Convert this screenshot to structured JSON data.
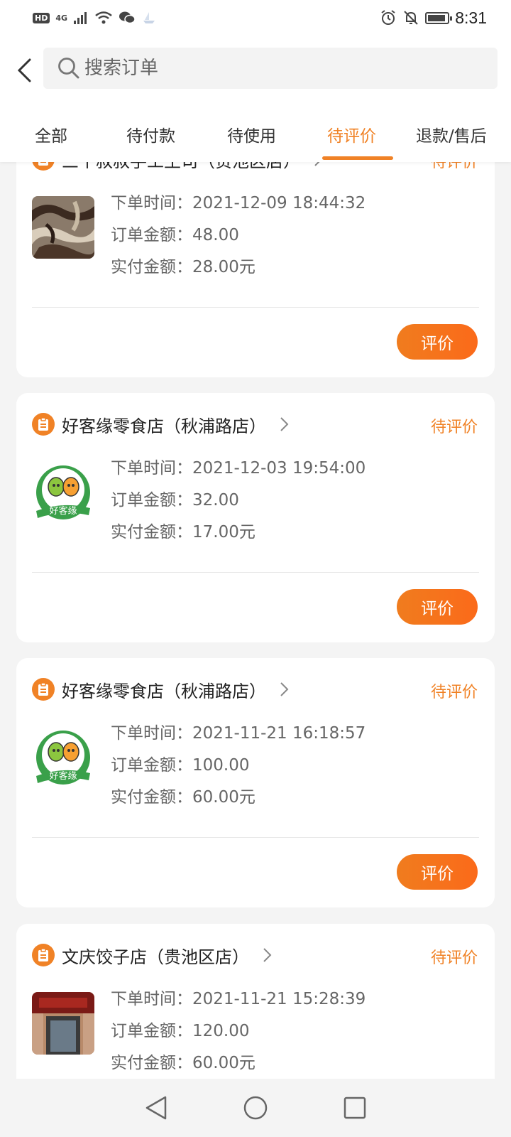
{
  "status_bar": {
    "hd": "HD",
    "signal": "4G",
    "time": "8:31"
  },
  "header": {
    "search_placeholder": "搜索订单"
  },
  "tabs": [
    {
      "label": "全部",
      "active": false
    },
    {
      "label": "待付款",
      "active": false
    },
    {
      "label": "待使用",
      "active": false
    },
    {
      "label": "待评价",
      "active": true
    },
    {
      "label": "退款/售后",
      "active": false
    }
  ],
  "labels": {
    "order_time": "下单时间：",
    "order_amount": "订单金额：",
    "paid_amount": "实付金额：",
    "review_button": "评价"
  },
  "orders": [
    {
      "shop": "三个叔叔手工土司（贵池区店）",
      "status": "待评价",
      "time": "2021-12-09 18:44:32",
      "amount": "48.00",
      "paid": "28.00元",
      "thumb_icon": "marble-bread-thumb"
    },
    {
      "shop": "好客缘零食店（秋浦路店）",
      "status": "待评价",
      "time": "2021-12-03 19:54:00",
      "amount": "32.00",
      "paid": "17.00元",
      "thumb_icon": "haokeyuan-logo",
      "logo_text": "好客缘"
    },
    {
      "shop": "好客缘零食店（秋浦路店）",
      "status": "待评价",
      "time": "2021-11-21 16:18:57",
      "amount": "100.00",
      "paid": "60.00元",
      "thumb_icon": "haokeyuan-logo",
      "logo_text": "好客缘"
    },
    {
      "shop": "文庆饺子店（贵池区店）",
      "status": "待评价",
      "time": "2021-11-21 15:28:39",
      "amount": "120.00",
      "paid": "60.00元",
      "thumb_icon": "storefront-thumb"
    }
  ],
  "colors": {
    "accent": "#f08226",
    "button_gradient_start": "#f07c1e",
    "button_gradient_end": "#fb6a1a"
  }
}
